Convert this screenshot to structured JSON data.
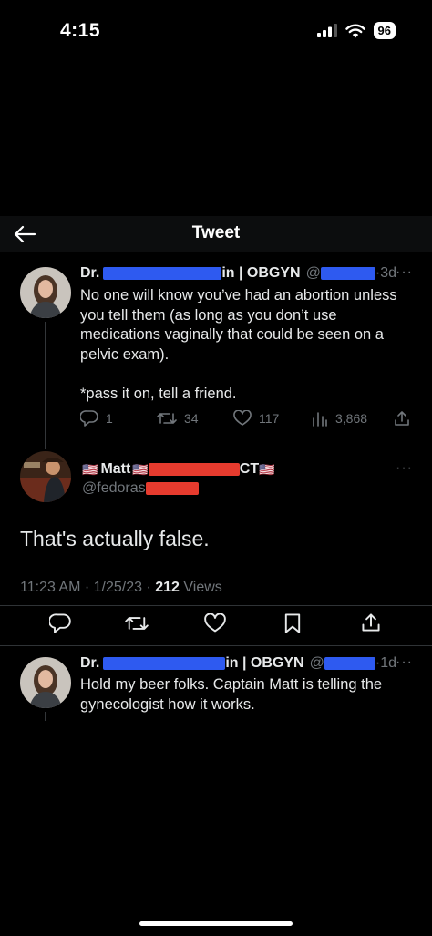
{
  "status_bar": {
    "time": "4:15",
    "battery": "96"
  },
  "header": {
    "title": "Tweet"
  },
  "tweet1": {
    "name_prefix": "Dr.",
    "name_suffix": "in | OBGYN",
    "handle_prefix": "@",
    "time": "3d",
    "more": "···",
    "text_line1": "No one will know you’ve had an abortion unless",
    "text_line2": "you tell them (as long as you don’t use",
    "text_line3": "medications vaginally that could be seen on a",
    "text_line4": "pelvic exam).",
    "text_line5": "*pass it on, tell a friend.",
    "replies": "1",
    "retweets": "34",
    "likes": "117",
    "views": "3,868"
  },
  "tweet2": {
    "flag": "🇺🇸",
    "name": "Matt",
    "name_mid": "CT",
    "handle_prefix": "@fedoras",
    "more": "···",
    "text": "That's actually false.",
    "timestamp": "11:23 AM · 1/25/23 · ",
    "views_count": "212",
    "views_label": " Views"
  },
  "tweet3": {
    "name_prefix": "Dr.",
    "name_suffix": "in | OBGYN",
    "handle_prefix": "@",
    "time": "1d",
    "more": "···",
    "text_line1": "Hold my beer folks. Captain Matt is telling the",
    "text_line2": "gynecologist how it works."
  },
  "icons": [
    "back-arrow-icon",
    "reply-icon",
    "retweet-icon",
    "like-icon",
    "views-icon",
    "share-icon",
    "bookmark-icon",
    "more-icon",
    "signal-icon",
    "wifi-icon",
    "battery-icon"
  ],
  "colors": {
    "background": "#000000",
    "muted": "#71767b",
    "text": "#e7e9ea",
    "redact_blue": "#2e5af0",
    "redact_red": "#e63b2e"
  }
}
